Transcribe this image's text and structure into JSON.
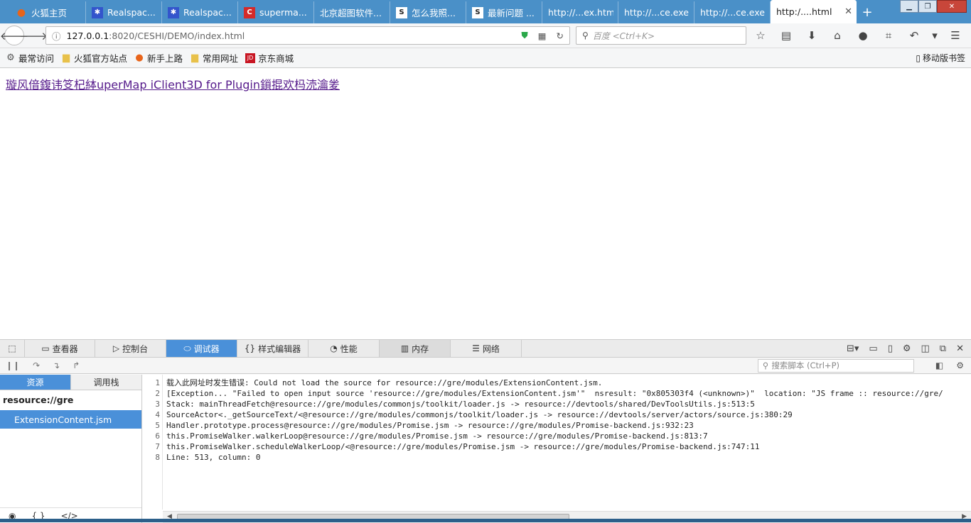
{
  "tabs": [
    {
      "label": "火狐主页",
      "icon": "firefox-icon",
      "color": "#e8641a"
    },
    {
      "label": "Realspac...",
      "icon": "paw-icon",
      "color": "#3355cc"
    },
    {
      "label": "Realspac...",
      "icon": "paw-icon",
      "color": "#3355cc"
    },
    {
      "label": "superma...",
      "icon": "c-logo-icon",
      "color": "#d42a2a"
    },
    {
      "label": "北京超图软件...",
      "icon": "",
      "color": ""
    },
    {
      "label": "怎么我照...",
      "icon": "s-logo-icon",
      "color": "#ffffff"
    },
    {
      "label": "最新问题 ...",
      "icon": "s-logo-icon",
      "color": "#ffffff"
    },
    {
      "label": "http://...ex.html",
      "icon": "",
      "color": ""
    },
    {
      "label": "http://...ce.exe",
      "icon": "",
      "color": ""
    },
    {
      "label": "http://...ce.exe",
      "icon": "",
      "color": ""
    }
  ],
  "active_tab": {
    "label": "http:/....html"
  },
  "url": {
    "host": "127.0.0.1",
    "path": ":8020/CESHI/DEMO/index.html"
  },
  "search_placeholder": "百度 <Ctrl+K>",
  "bookmarks": [
    {
      "label": "最常访问",
      "icon": "gear-icon",
      "color": "#555555"
    },
    {
      "label": "火狐官方站点",
      "icon": "folder-icon",
      "color": "#e8c14a"
    },
    {
      "label": "新手上路",
      "icon": "firefox-icon",
      "color": "#e8641a"
    },
    {
      "label": "常用网址",
      "icon": "folder-icon",
      "color": "#e8c14a"
    },
    {
      "label": "京东商城",
      "icon": "jd-icon",
      "color": "#c81623"
    }
  ],
  "mobile_bookmarks": "移动版书签",
  "page_link": "璇风偣鍑讳笅杞絊uperMap iClient3D for Plugin鎻掍欢杩涜瀹夎",
  "devtools": {
    "tabs": [
      {
        "label": "查看器",
        "icon": "inspector-icon",
        "width": 99
      },
      {
        "label": "控制台",
        "icon": "console-icon",
        "width": 100
      },
      {
        "label": "调试器",
        "icon": "debugger-icon",
        "width": 100
      },
      {
        "label": "样式编辑器",
        "icon": "style-editor-icon",
        "width": 100
      },
      {
        "label": "性能",
        "icon": "performance-icon",
        "width": 100
      },
      {
        "label": "内存",
        "icon": "memory-icon",
        "width": 100
      },
      {
        "label": "网络",
        "icon": "network-icon",
        "width": 100
      }
    ],
    "search_scripts_placeholder": "搜索脚本 (Ctrl+P)",
    "source_tabs": {
      "resources": "资源",
      "callstack": "调用栈"
    },
    "source_root": "resource://gre",
    "source_file": "ExtensionContent.jsm",
    "footer": {
      "eye": "◉",
      "braces": "{ }",
      "blackbox": "</>"
    },
    "code_lines": [
      "载入此网址时发生错误: Could not load the source for resource://gre/modules/ExtensionContent.jsm.",
      "[Exception... \"Failed to open input source 'resource://gre/modules/ExtensionContent.jsm'\"  nsresult: \"0x805303f4 (<unknown>)\"  location: \"JS frame :: resource://gre/",
      "Stack: mainThreadFetch@resource://gre/modules/commonjs/toolkit/loader.js -> resource://devtools/shared/DevToolsUtils.js:513:5",
      "SourceActor<._getSourceText/<@resource://gre/modules/commonjs/toolkit/loader.js -> resource://devtools/server/actors/source.js:380:29",
      "Handler.prototype.process@resource://gre/modules/Promise.jsm -> resource://gre/modules/Promise-backend.js:932:23",
      "this.PromiseWalker.walkerLoop@resource://gre/modules/Promise.jsm -> resource://gre/modules/Promise-backend.js:813:7",
      "this.PromiseWalker.scheduleWalkerLoop/<@resource://gre/modules/Promise.jsm -> resource://gre/modules/Promise-backend.js:747:11",
      "Line: 513, column: 0"
    ],
    "line_numbers": [
      "1",
      "2",
      "3",
      "4",
      "5",
      "6",
      "7",
      "8"
    ]
  }
}
